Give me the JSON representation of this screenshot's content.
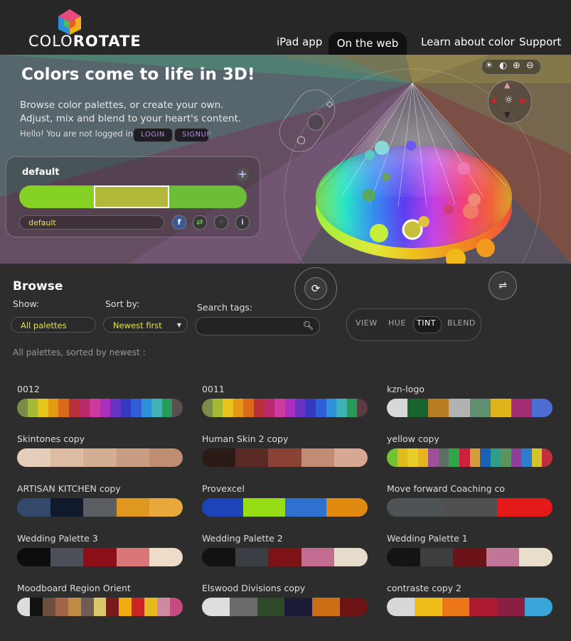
{
  "brand": {
    "logo_text_a": "COLO",
    "logo_text_b": "ROTATE"
  },
  "nav": {
    "items": [
      "iPad app",
      "On the web",
      "Learn about color",
      "Support"
    ],
    "active": "On the web"
  },
  "hero": {
    "title": "Colors come to life in 3D!",
    "subtitle": "Browse color palettes, or create your own. Adjust, mix and blend to your heart's content.",
    "login_status": "Hello! You are not logged in.",
    "login_label": "LOGIN",
    "signup_label": "SIGNUP"
  },
  "editor": {
    "name": "default",
    "field_value": "default",
    "colors": [
      "#86d224",
      "#b1b83a",
      "#6cbd38"
    ],
    "selected_index": 1
  },
  "browse": {
    "title": "Browse",
    "show_label": "Show:",
    "show_value": "All palettes",
    "sort_label": "Sort by:",
    "sort_value": "Newest first",
    "search_label": "Search tags:",
    "search_value": "",
    "sorted_caption": "All palettes, sorted by newest :",
    "view_modes": [
      "VIEW",
      "HUE",
      "TINT",
      "BLEND"
    ],
    "active_view_mode": "TINT"
  },
  "palettes": [
    {
      "name": "0012",
      "colors": [
        "#7a8c48",
        "#a6b82f",
        "#e7c41b",
        "#e39a12",
        "#d86a1a",
        "#b8303a",
        "#b92868",
        "#cc3a9d",
        "#a930bd",
        "#6a32c4",
        "#3738c0",
        "#2f5ed6",
        "#2d91d8",
        "#3fb2b6",
        "#289b5a",
        "#5a4e4e"
      ]
    },
    {
      "name": "0011",
      "colors": [
        "#7a8c48",
        "#a6b82f",
        "#e7c41b",
        "#e39a12",
        "#d86a1a",
        "#b8303a",
        "#b92868",
        "#cc3a9d",
        "#a930bd",
        "#6a32c4",
        "#3738c0",
        "#2f5ed6",
        "#2d91d8",
        "#3fb2b6",
        "#289b5a",
        "#5a3c40"
      ]
    },
    {
      "name": "kzn-logo",
      "colors": [
        "#d8d8d8",
        "#18642c",
        "#b87d22",
        "#b2b2b2",
        "#5f8f6f",
        "#dfb41a",
        "#a22d72",
        "#4b6ed0"
      ]
    },
    {
      "name": "Skintones copy",
      "colors": [
        "#e5cdb9",
        "#ddbca3",
        "#d4ae93",
        "#c99d83",
        "#be8d72"
      ]
    },
    {
      "name": "Human Skin 2 copy",
      "colors": [
        "#2c1a16",
        "#5a2b24",
        "#8a4234",
        "#c08c74",
        "#d7a893"
      ]
    },
    {
      "name": "yellow copy",
      "colors": [
        "#74c233",
        "#e0bb19",
        "#e8cc2b",
        "#e5b41f",
        "#a04f9b",
        "#5f6e64",
        "#2fa54c",
        "#d0213c",
        "#d69c3d",
        "#1a61b8",
        "#2f9d8c",
        "#5c9460",
        "#8e3f9b",
        "#2d7dce",
        "#d4c32c",
        "#c0303a"
      ]
    },
    {
      "name": "ARTISAN KITCHEN copy",
      "colors": [
        "#33496c",
        "#111a2c",
        "#5a5d62",
        "#e09720",
        "#e9a83a"
      ]
    },
    {
      "name": "Provexcel",
      "colors": [
        "#1d44b8",
        "#96dd16",
        "#2f71cf",
        "#e18a10"
      ]
    },
    {
      "name": "Move forward Coaching co",
      "colors": [
        "#4e5356",
        "#505050",
        "#e41a1a"
      ]
    },
    {
      "name": "Wedding Palette 3",
      "colors": [
        "#0d0d0d",
        "#4e5059",
        "#8c0e18",
        "#d97778",
        "#eedcc9"
      ]
    },
    {
      "name": "Wedding Palette 2",
      "colors": [
        "#121212",
        "#3b3e42",
        "#7d1315",
        "#c26d8f",
        "#e8dccc"
      ]
    },
    {
      "name": "Wedding Palette 1",
      "colors": [
        "#141414",
        "#3e3e3e",
        "#6b1316",
        "#c17698",
        "#e9ddcb"
      ]
    },
    {
      "name": "Moodboard Region Orient",
      "colors": [
        "#dcdcdc",
        "#111111",
        "#6a4f3d",
        "#a16448",
        "#c08a47",
        "#6e5d54",
        "#d9c96a",
        "#7a1a1a",
        "#f0ac12",
        "#cc2525",
        "#e5ba1f",
        "#cf8aa2",
        "#c64b84"
      ]
    },
    {
      "name": "Elswood Divisions copy",
      "colors": [
        "#dedede",
        "#6b6b6b",
        "#2e4a2b",
        "#1c1c36",
        "#cc6e15",
        "#6e1414"
      ]
    },
    {
      "name": "contraste copy 2",
      "colors": [
        "#d8d8d8",
        "#efbe1a",
        "#ec7719",
        "#ad1a30",
        "#8c1d43",
        "#38a6d8"
      ]
    }
  ],
  "colors": {
    "accent_yellow": "#e6e24a",
    "accent_purple": "#b58ee0",
    "background": "#2d2d2d"
  }
}
